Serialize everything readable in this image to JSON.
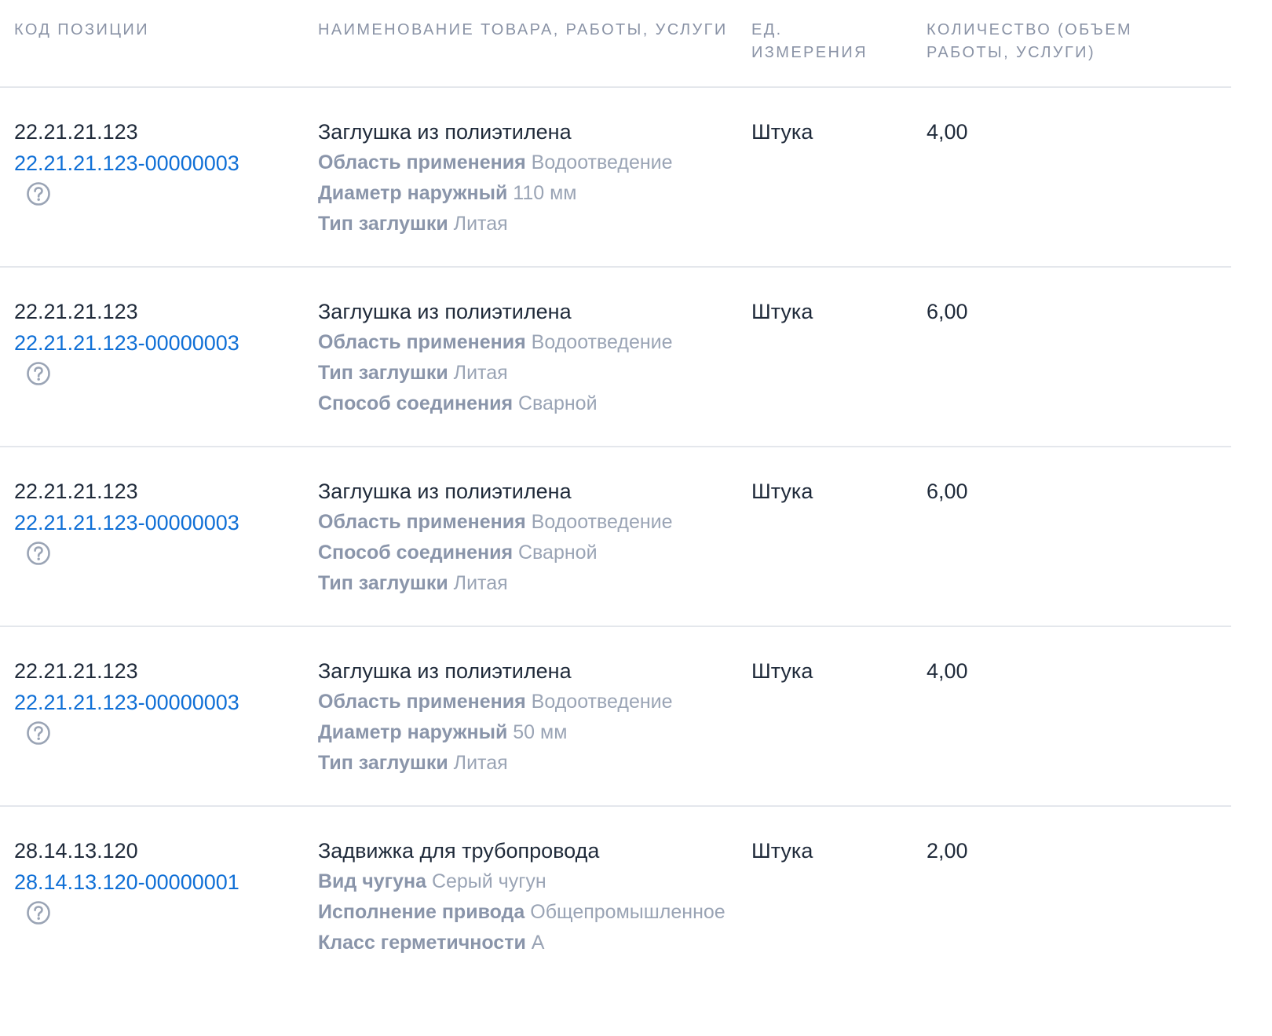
{
  "header": {
    "col_code": "Код позиции",
    "col_name": "Наименование товара, работы, услуги",
    "col_unit": "Ед. измерения",
    "col_qty": "Количество (объем работы, услуги)"
  },
  "rows": [
    {
      "code": "22.21.21.123",
      "code_link": "22.21.21.123-00000003",
      "name": "Заглушка из полиэтилена",
      "attrs": [
        {
          "label": "Область применения",
          "value": "Водоотведение"
        },
        {
          "label": "Диаметр наружный",
          "value": "110 мм"
        },
        {
          "label": "Тип заглушки",
          "value": "Литая"
        }
      ],
      "unit": "Штука",
      "qty": "4,00"
    },
    {
      "code": "22.21.21.123",
      "code_link": "22.21.21.123-00000003",
      "name": "Заглушка из полиэтилена",
      "attrs": [
        {
          "label": "Область применения",
          "value": "Водоотведение"
        },
        {
          "label": "Тип заглушки",
          "value": "Литая"
        },
        {
          "label": "Способ соединения",
          "value": "Сварной"
        }
      ],
      "unit": "Штука",
      "qty": "6,00"
    },
    {
      "code": "22.21.21.123",
      "code_link": "22.21.21.123-00000003",
      "name": "Заглушка из полиэтилена",
      "attrs": [
        {
          "label": "Область применения",
          "value": "Водоотведение"
        },
        {
          "label": "Способ соединения",
          "value": "Сварной"
        },
        {
          "label": "Тип заглушки",
          "value": "Литая"
        }
      ],
      "unit": "Штука",
      "qty": "6,00"
    },
    {
      "code": "22.21.21.123",
      "code_link": "22.21.21.123-00000003",
      "name": "Заглушка из полиэтилена",
      "attrs": [
        {
          "label": "Область применения",
          "value": "Водоотведение"
        },
        {
          "label": "Диаметр наружный",
          "value": "50 мм"
        },
        {
          "label": "Тип заглушки",
          "value": "Литая"
        }
      ],
      "unit": "Штука",
      "qty": "4,00"
    },
    {
      "code": "28.14.13.120",
      "code_link": "28.14.13.120-00000001",
      "name": "Задвижка для трубопровода",
      "attrs": [
        {
          "label": "Вид чугуна",
          "value": "Серый чугун"
        },
        {
          "label": "Исполнение привода",
          "value": "Общепромышленное"
        },
        {
          "label": "Класс герметичности",
          "value": "А"
        }
      ],
      "unit": "Штука",
      "qty": "2,00"
    }
  ],
  "icons": {
    "help": "question-circle-icon"
  },
  "colors": {
    "link": "#0f6fd6",
    "text": "#1f2a3a",
    "muted": "#9aa4b5",
    "header": "#8a93a6",
    "divider": "#e4e7ec"
  }
}
